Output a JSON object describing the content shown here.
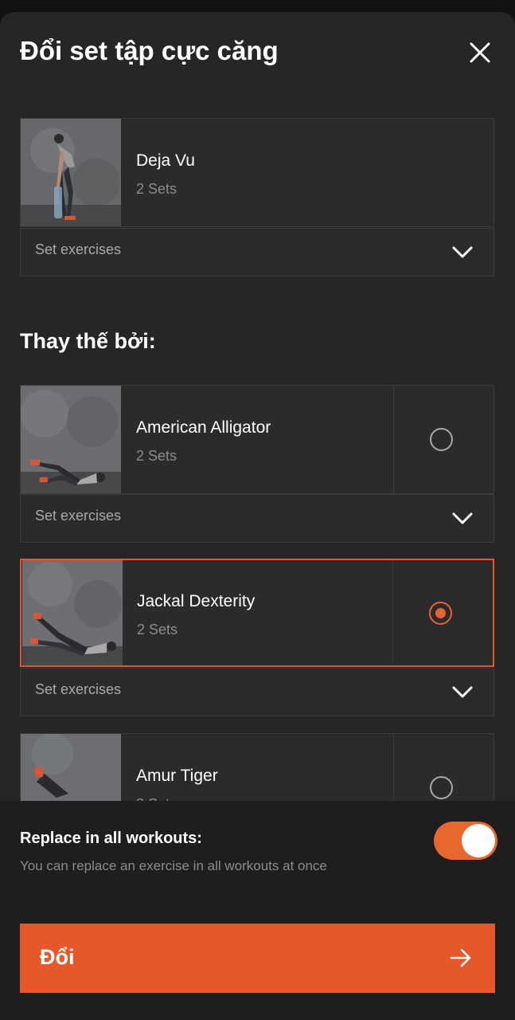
{
  "header": {
    "title": "Đổi set tập cực căng",
    "close_icon": "close-icon"
  },
  "current": {
    "name": "Deja Vu",
    "sets": "2 Sets",
    "expander_label": "Set exercises"
  },
  "section_title": "Thay thế bởi:",
  "options": [
    {
      "name": "American Alligator",
      "sets": "2 Sets",
      "expander_label": "Set exercises",
      "selected": false
    },
    {
      "name": "Jackal Dexterity",
      "sets": "2 Sets",
      "expander_label": "Set exercises",
      "selected": true
    },
    {
      "name": "Amur Tiger",
      "sets": "2 Sets",
      "selected": false
    }
  ],
  "replace_all": {
    "title": "Replace in all workouts:",
    "description": "You can replace an exercise in all workouts at once",
    "enabled": true
  },
  "cta": {
    "label": "Đổi",
    "icon": "arrow-right-icon"
  },
  "colors": {
    "accent": "#e65729",
    "sheet": "#262626",
    "card": "#2b2b2b",
    "bottom": "#1e1e1e"
  }
}
